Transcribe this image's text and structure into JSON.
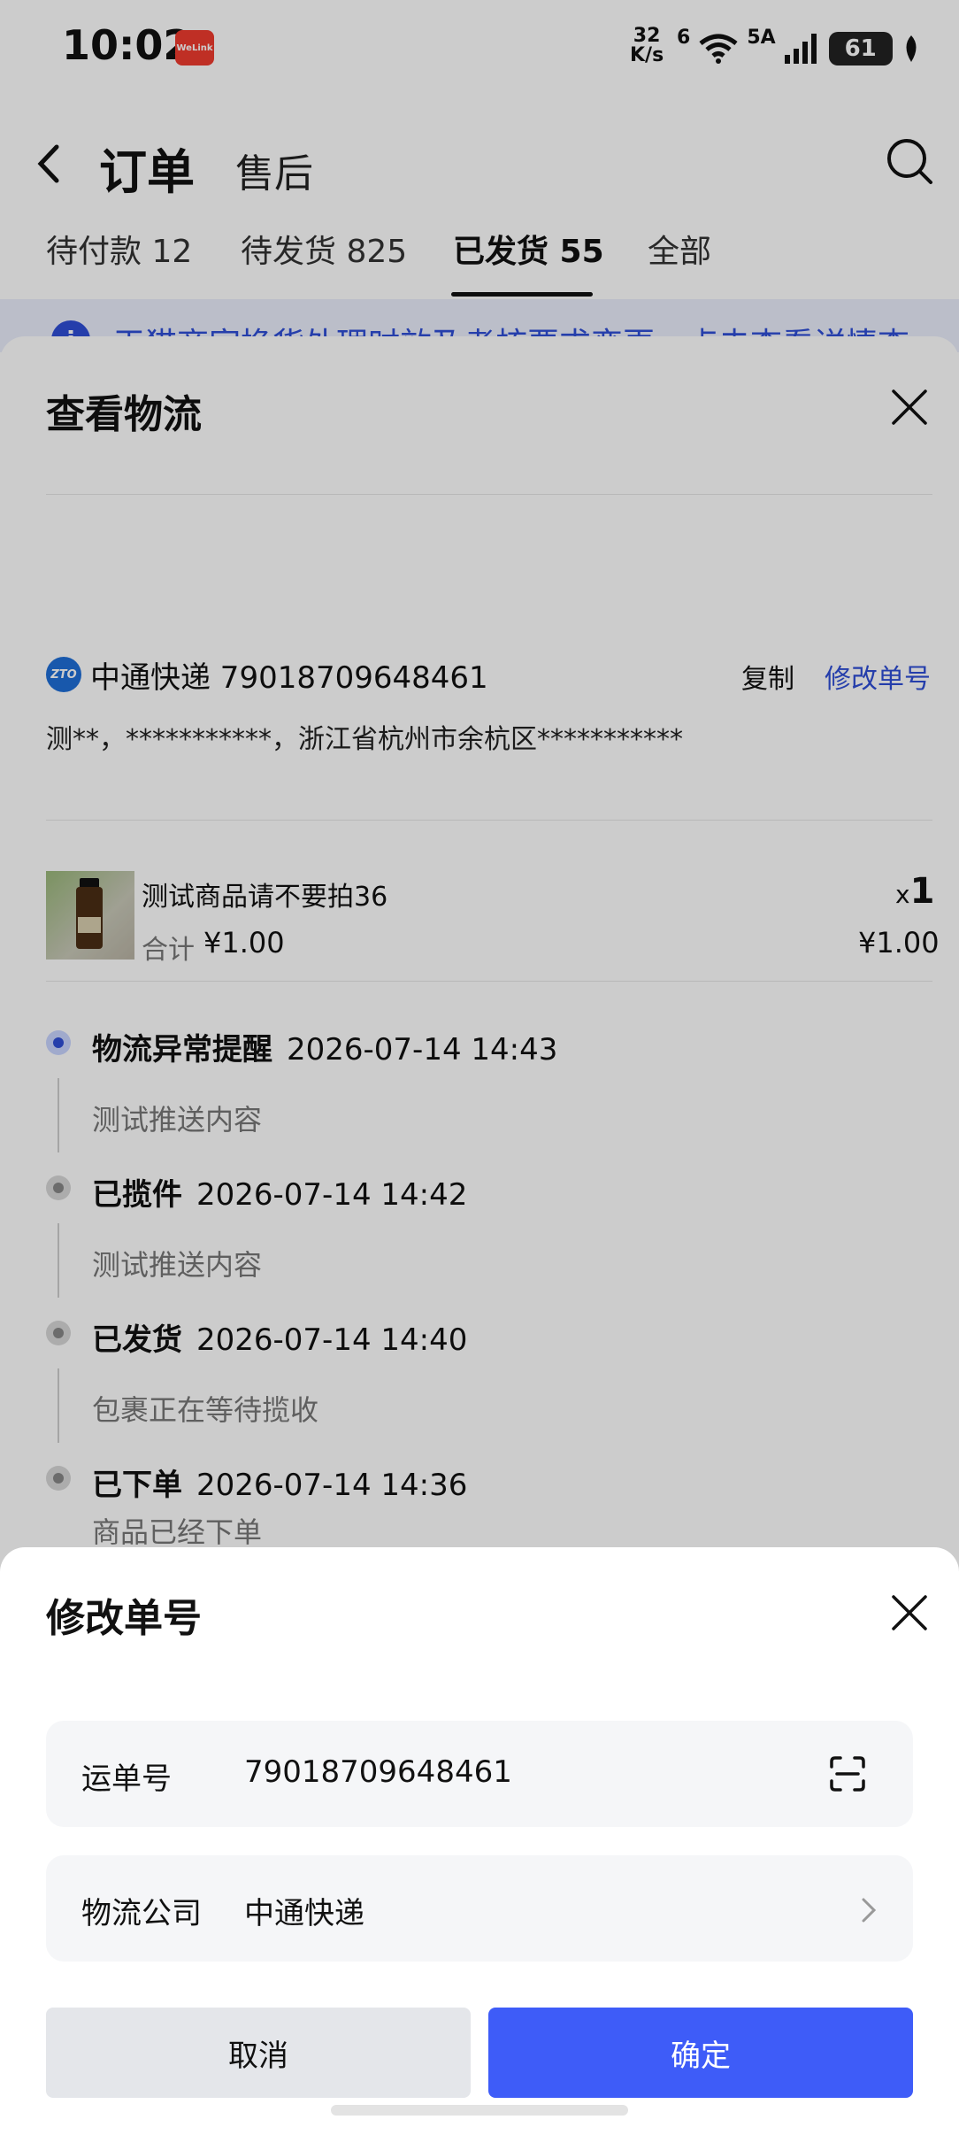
{
  "status_bar": {
    "time": "10:02",
    "app_badge": "WeLink",
    "net_speed_top": "32",
    "net_speed_bottom": "K/s",
    "wifi_label": "6",
    "signal_label": "5A",
    "battery": "61"
  },
  "nav": {
    "title": "订单",
    "subtitle": "售后"
  },
  "tabs": [
    {
      "label": "待付款 12"
    },
    {
      "label": "待发货 825"
    },
    {
      "label": "已发货 55"
    },
    {
      "label": "全部"
    }
  ],
  "active_tab": 2,
  "notice": {
    "text": "天猫商家换货处理时效及考核要求变更，点击查看详情查"
  },
  "logistics_sheet": {
    "title": "查看物流",
    "courier": "中通快递 79018709648461",
    "courier_logo": "ZTO",
    "copy_label": "复制",
    "modify_label": "修改单号",
    "address": "测**，***********，浙江省杭州市余杭区***********",
    "goods": {
      "name": "测试商品请不要拍36",
      "qty_prefix": "x",
      "qty": "1",
      "total_label": "合计",
      "total": "¥1.00",
      "price": "¥1.00"
    },
    "timeline": [
      {
        "status": "物流异常提醒",
        "time": "2026-07-14 14:43",
        "desc": "测试推送内容"
      },
      {
        "status": "已揽件",
        "time": "2026-07-14 14:42",
        "desc": "测试推送内容"
      },
      {
        "status": "已发货",
        "time": "2026-07-14 14:40",
        "desc": "包裹正在等待揽收"
      },
      {
        "status": "已下单",
        "time": "2026-07-14 14:36",
        "desc": "商品已经下单"
      }
    ]
  },
  "modify_sheet": {
    "title": "修改单号",
    "tracking_label": "运单号",
    "tracking_value": "79018709648461",
    "company_label": "物流公司",
    "company_value": "中通快递",
    "cancel_label": "取消",
    "confirm_label": "确定"
  },
  "colors": {
    "accent": "#3e5cf8",
    "link": "#2f4ed6"
  }
}
